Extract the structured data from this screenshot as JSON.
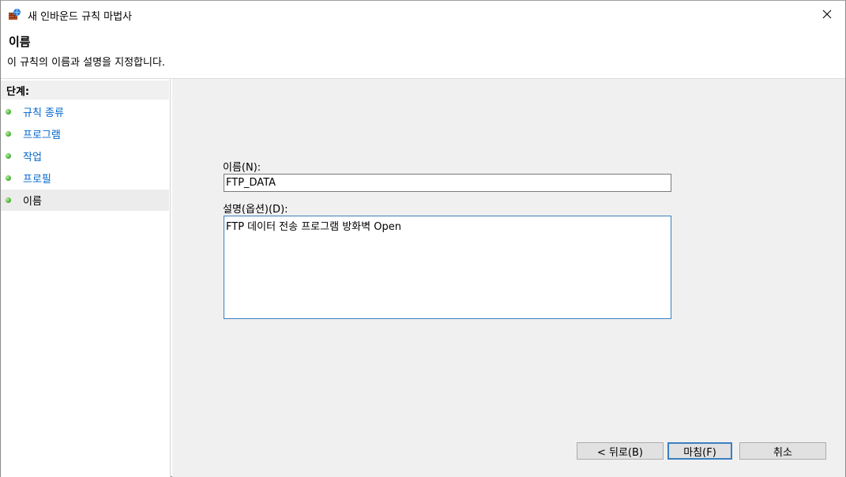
{
  "window": {
    "title": "새 인바운드 규칙 마법사"
  },
  "header": {
    "title": "이름",
    "subtitle": "이 규칙의 이름과 설명을 지정합니다."
  },
  "steps": {
    "heading": "단계:",
    "items": [
      {
        "label": "규칙 종류"
      },
      {
        "label": "프로그램"
      },
      {
        "label": "작업"
      },
      {
        "label": "프로필"
      },
      {
        "label": "이름"
      }
    ]
  },
  "form": {
    "name_label": "이름(N):",
    "name_value": "FTP_DATA",
    "desc_label": "설명(옵션)(D):",
    "desc_value": "FTP 데이터 전송 프로그램 방화벽 Open"
  },
  "buttons": {
    "back": "< 뒤로(B)",
    "finish": "마침(F)",
    "cancel": "취소"
  },
  "colors": {
    "link": "#0066cc",
    "focus_border": "#3c7fc1",
    "panel_bg": "#f0f0f0"
  }
}
